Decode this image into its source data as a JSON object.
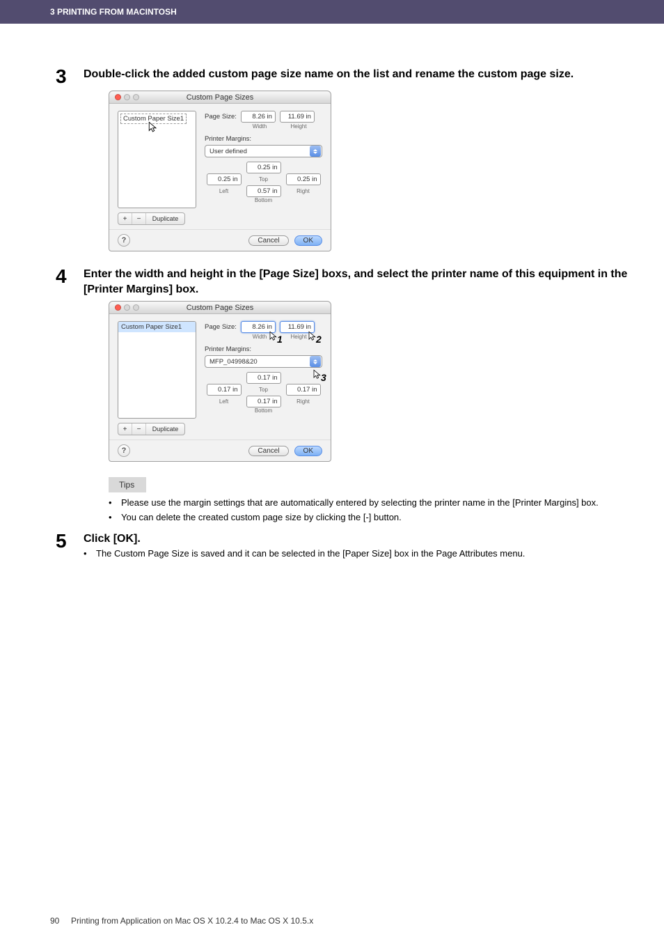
{
  "header": {
    "breadcrumb": "3 PRINTING FROM MACINTOSH"
  },
  "steps": {
    "s3": {
      "num": "3",
      "heading": "Double-click the added custom page size name on the list and rename the custom page size.",
      "dialog": {
        "title": "Custom Page Sizes",
        "list_item": "Custom Paper Size1",
        "btn_plus": "+",
        "btn_minus": "−",
        "btn_dup": "Duplicate",
        "page_size_label": "Page Size:",
        "width_val": "8.26 in",
        "width_lbl": "Width",
        "height_val": "11.69 in",
        "height_lbl": "Height",
        "margins_label": "Printer Margins:",
        "dropdown": "User defined",
        "top_val": "0.25 in",
        "top_lbl": "Top",
        "left_val": "0.25 in",
        "left_lbl": "Left",
        "right_val": "0.25 in",
        "right_lbl": "Right",
        "bottom_val": "0.57 in",
        "bottom_lbl": "Bottom",
        "cancel": "Cancel",
        "ok": "OK"
      }
    },
    "s4": {
      "num": "4",
      "heading": "Enter the width and height in the [Page Size] boxs, and select the printer name of this equipment in the [Printer Margins] box.",
      "dialog": {
        "title": "Custom Page Sizes",
        "list_item": "Custom Paper Size1",
        "btn_plus": "+",
        "btn_minus": "−",
        "btn_dup": "Duplicate",
        "page_size_label": "Page Size:",
        "width_val": "8.26 in",
        "width_lbl": "Width",
        "height_val": "11.69 in",
        "height_lbl": "Height",
        "margins_label": "Printer Margins:",
        "dropdown": "MFP_04998&20",
        "top_val": "0.17 in",
        "top_lbl": "Top",
        "left_val": "0.17 in",
        "left_lbl": "Left",
        "right_val": "0.17 in",
        "right_lbl": "Right",
        "bottom_val": "0.17 in",
        "bottom_lbl": "Bottom",
        "cancel": "Cancel",
        "ok": "OK"
      },
      "callouts": {
        "c1": "1",
        "c2": "2",
        "c3": "3"
      },
      "tips_label": "Tips",
      "tip1": "Please use the margin settings that are automatically entered by selecting the printer name in the [Printer Margins] box.",
      "tip2": "You can delete the created custom page size by clicking the [-] button."
    },
    "s5": {
      "num": "5",
      "heading": "Click [OK].",
      "bullet": "The Custom Page Size is saved and it can be selected in the [Paper Size] box in the Page Attributes menu."
    }
  },
  "footer": {
    "page_num": "90",
    "text": "Printing from Application on Mac OS X 10.2.4 to Mac OS X 10.5.x"
  }
}
